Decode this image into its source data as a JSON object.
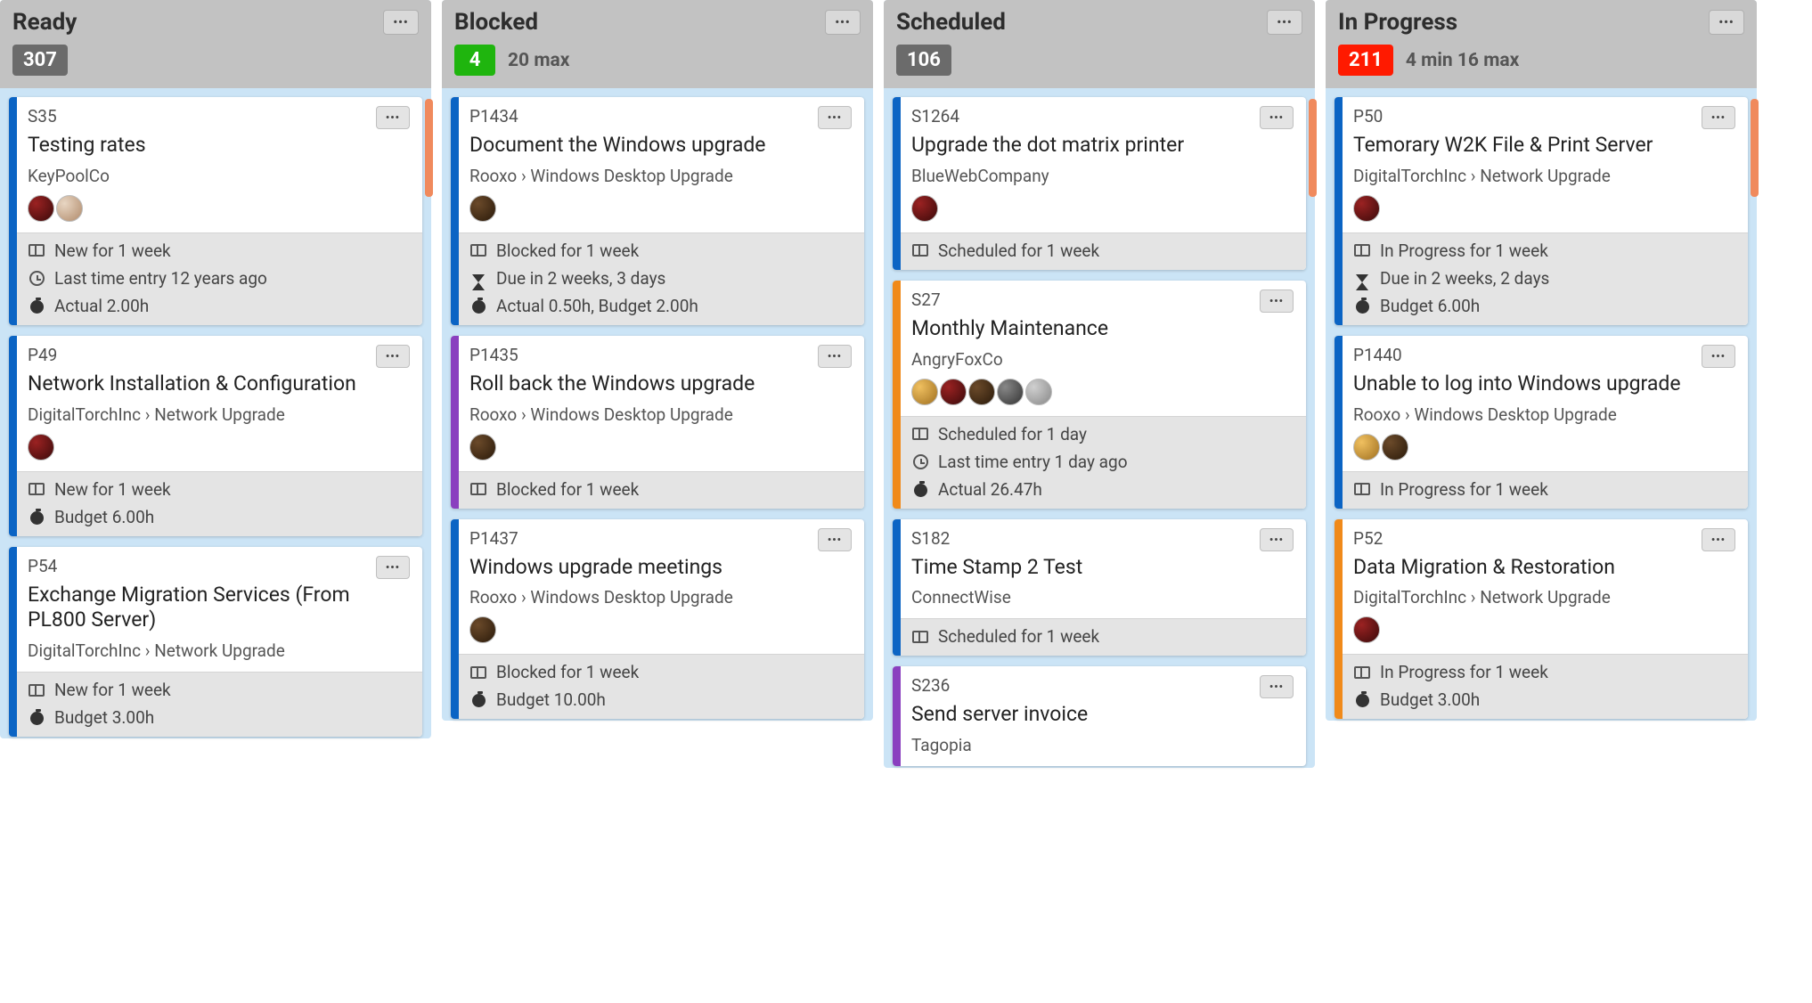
{
  "columns": [
    {
      "title": "Ready",
      "count": "307",
      "count_class": "badge-gray",
      "limit": "",
      "scroll_indicator": true,
      "cards": [
        {
          "stripe": "stripe-blue",
          "id": "S35",
          "title": "Testing rates",
          "sub": "KeyPoolCo",
          "avatars": [
            "av-1",
            "av-2"
          ],
          "meta": [
            {
              "icon": "board",
              "text": "New for 1 week"
            },
            {
              "icon": "clock",
              "text": "Last time entry 12 years ago"
            },
            {
              "icon": "stopwatch",
              "text": "Actual 2.00h"
            }
          ]
        },
        {
          "stripe": "stripe-blue",
          "id": "P49",
          "title": "Network Installation & Configuration",
          "sub": "DigitalTorchInc › Network Upgrade",
          "avatars": [
            "av-1"
          ],
          "meta": [
            {
              "icon": "board",
              "text": "New for 1 week"
            },
            {
              "icon": "stopwatch",
              "text": "Budget 6.00h"
            }
          ]
        },
        {
          "stripe": "stripe-blue",
          "id": "P54",
          "title": "Exchange Migration Services (From PL800 Server)",
          "sub": "DigitalTorchInc › Network Upgrade",
          "avatars": [],
          "meta": [
            {
              "icon": "board",
              "text": "New for 1 week"
            },
            {
              "icon": "stopwatch",
              "text": "Budget 3.00h"
            }
          ]
        }
      ]
    },
    {
      "title": "Blocked",
      "count": "4",
      "count_class": "badge-green",
      "limit": "20 max",
      "scroll_indicator": false,
      "cards": [
        {
          "stripe": "stripe-blue",
          "id": "P1434",
          "title": "Document the Windows upgrade",
          "sub": "Rooxo › Windows Desktop Upgrade",
          "avatars": [
            "av-3"
          ],
          "meta": [
            {
              "icon": "board",
              "text": "Blocked for 1 week"
            },
            {
              "icon": "hourglass",
              "text": "Due in 2 weeks, 3 days"
            },
            {
              "icon": "stopwatch",
              "text": "Actual 0.50h, Budget 2.00h"
            }
          ]
        },
        {
          "stripe": "stripe-purple",
          "id": "P1435",
          "title": "Roll back the Windows upgrade",
          "sub": "Rooxo › Windows Desktop Upgrade",
          "avatars": [
            "av-3"
          ],
          "meta": [
            {
              "icon": "board",
              "text": "Blocked for 1 week"
            }
          ]
        },
        {
          "stripe": "stripe-blue",
          "id": "P1437",
          "title": "Windows upgrade meetings",
          "sub": "Rooxo › Windows Desktop Upgrade",
          "avatars": [
            "av-3"
          ],
          "meta": [
            {
              "icon": "board",
              "text": "Blocked for 1 week"
            },
            {
              "icon": "stopwatch",
              "text": "Budget 10.00h"
            }
          ]
        }
      ]
    },
    {
      "title": "Scheduled",
      "count": "106",
      "count_class": "badge-gray",
      "limit": "",
      "scroll_indicator": true,
      "cards": [
        {
          "stripe": "stripe-blue",
          "id": "S1264",
          "title": "Upgrade the dot matrix printer",
          "sub": "BlueWebCompany",
          "avatars": [
            "av-1"
          ],
          "meta": [
            {
              "icon": "board",
              "text": "Scheduled for 1 week"
            }
          ]
        },
        {
          "stripe": "stripe-orange",
          "id": "S27",
          "title": "Monthly Maintenance",
          "sub": "AngryFoxCo",
          "avatars": [
            "av-4",
            "av-1",
            "av-3",
            "av-5",
            "av-6"
          ],
          "meta": [
            {
              "icon": "board",
              "text": "Scheduled for 1 day"
            },
            {
              "icon": "clock",
              "text": "Last time entry 1 day ago"
            },
            {
              "icon": "stopwatch",
              "text": "Actual 26.47h"
            }
          ]
        },
        {
          "stripe": "stripe-blue",
          "id": "S182",
          "title": "Time Stamp 2 Test",
          "sub": "ConnectWise",
          "avatars": [],
          "meta": [
            {
              "icon": "board",
              "text": "Scheduled for 1 week"
            }
          ]
        },
        {
          "stripe": "stripe-purple",
          "id": "S236",
          "title": "Send server invoice",
          "sub": "Tagopia",
          "avatars": [],
          "meta": []
        }
      ]
    },
    {
      "title": "In Progress",
      "count": "211",
      "count_class": "badge-red",
      "limit": "4 min 16 max",
      "scroll_indicator": true,
      "cards": [
        {
          "stripe": "stripe-blue",
          "id": "P50",
          "title": "Temorary W2K File & Print Server",
          "sub": "DigitalTorchInc › Network Upgrade",
          "avatars": [
            "av-1"
          ],
          "meta": [
            {
              "icon": "board",
              "text": "In Progress for 1 week"
            },
            {
              "icon": "hourglass",
              "text": "Due in 2 weeks, 2 days"
            },
            {
              "icon": "stopwatch",
              "text": "Budget 6.00h"
            }
          ]
        },
        {
          "stripe": "stripe-blue",
          "id": "P1440",
          "title": "Unable to log into Windows upgrade",
          "sub": "Rooxo › Windows Desktop Upgrade",
          "avatars": [
            "av-4",
            "av-3"
          ],
          "meta": [
            {
              "icon": "board",
              "text": "In Progress for 1 week"
            }
          ]
        },
        {
          "stripe": "stripe-orange",
          "id": "P52",
          "title": "Data Migration & Restoration",
          "sub": "DigitalTorchInc › Network Upgrade",
          "avatars": [
            "av-1"
          ],
          "meta": [
            {
              "icon": "board",
              "text": "In Progress for 1 week"
            },
            {
              "icon": "stopwatch",
              "text": "Budget 3.00h"
            }
          ]
        }
      ]
    }
  ],
  "more_dots": "•••"
}
